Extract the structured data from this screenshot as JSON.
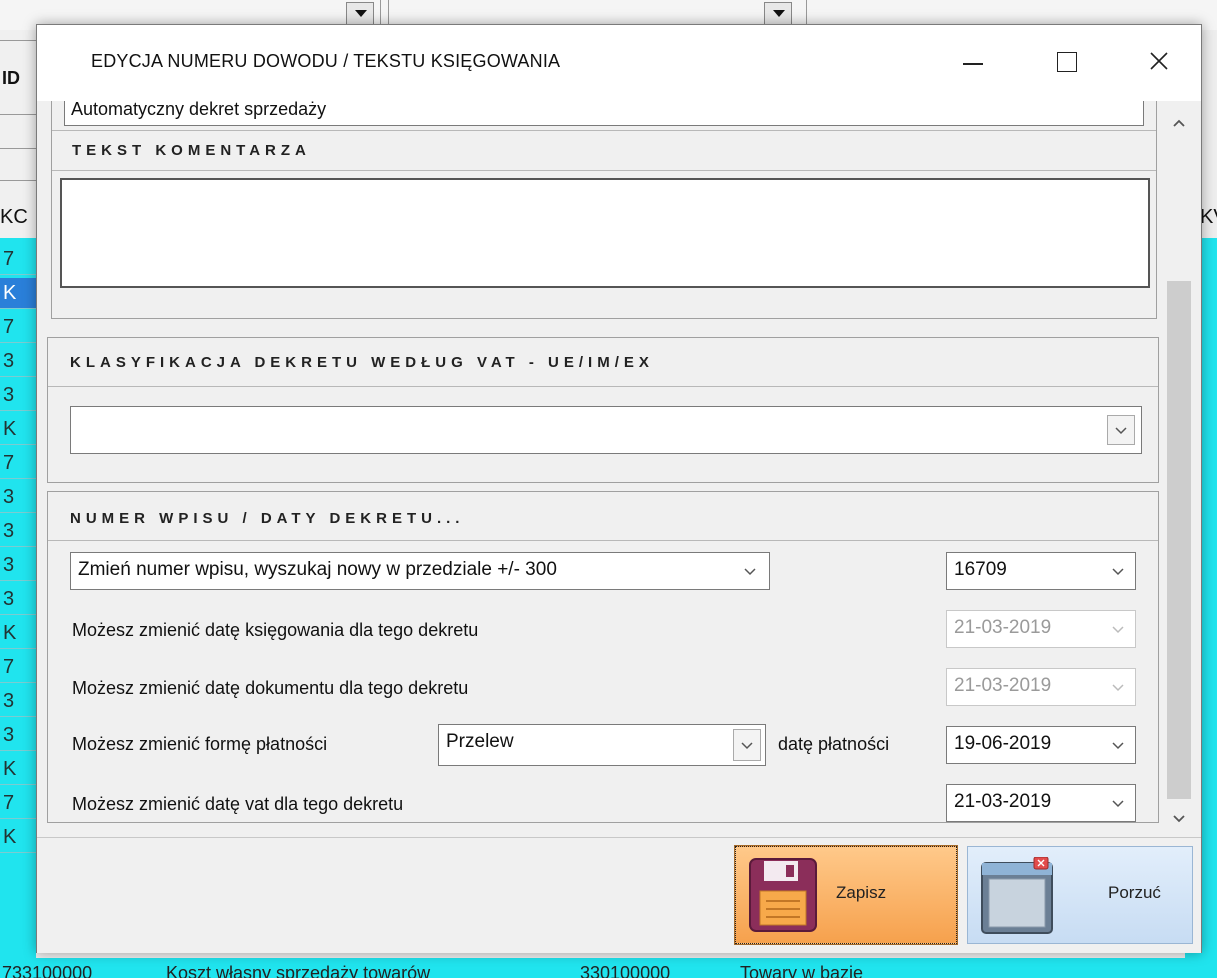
{
  "background": {
    "left_rows": [
      "7",
      "K",
      "7",
      "3",
      "3",
      "K",
      "7",
      "3",
      "3",
      "3",
      "3",
      "K",
      "7",
      "3",
      "3",
      "K",
      "7",
      "K"
    ],
    "selected_row_index": 1,
    "header_fragments": {
      "id": "ID",
      "kc": "KC",
      "kv": "KV"
    },
    "bottom_row": {
      "col1": "733100000",
      "col2": "Koszt własny sprzedaży towarów",
      "col3": "330100000",
      "col4": "Towary w bazie"
    }
  },
  "dialog": {
    "title": "EDYCJA NUMERU DOWODU / TEKSTU KSIĘGOWANIA",
    "posting_text": "Automatyczny dekret sprzedaży",
    "comment": {
      "title": "TEKST KOMENTARZA",
      "value": ""
    },
    "vat_classification": {
      "title": "KLASYFIKACJA DEKRETU WEDŁUG  VAT - UE/IM/EX",
      "selected": ""
    },
    "entry": {
      "title": "NUMER WPISU / DATY DEKRETU...",
      "renumber_option": "Zmień numer wpisu, wyszukaj nowy w przedziale +/- 300",
      "entry_number": "16709",
      "posting_date_label": "Możesz zmienić datę księgowania dla tego dekretu",
      "posting_date": "21-03-2019",
      "document_date_label": "Możesz zmienić datę dokumentu dla tego dekretu",
      "document_date": "21-03-2019",
      "payment_form_label": "Możesz zmienić formę płatności",
      "payment_form": "Przelew",
      "payment_date_label": "datę płatności",
      "payment_date": "19-06-2019",
      "vat_date_label": "Możesz zmienić datę vat dla tego dekretu",
      "vat_date": "21-03-2019"
    },
    "buttons": {
      "save": "Zapisz",
      "cancel": "Porzuć"
    }
  }
}
